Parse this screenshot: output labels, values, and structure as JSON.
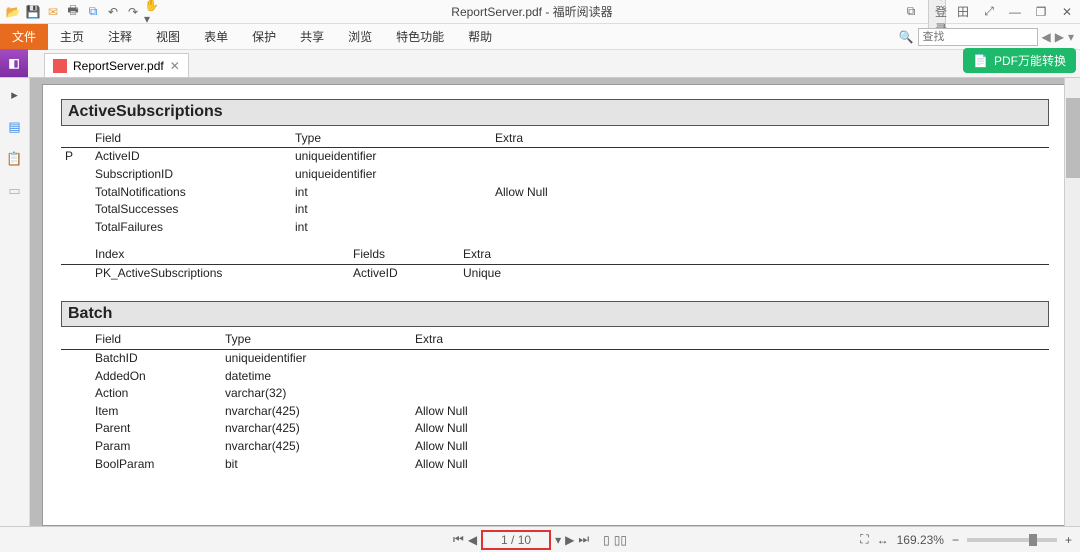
{
  "window": {
    "title": "ReportServer.pdf - 福昕阅读器",
    "not_logged_in": "未登录"
  },
  "qat_icons": [
    "folder-open",
    "save",
    "mail",
    "print",
    "undo",
    "redo",
    "hand",
    "select"
  ],
  "menu": {
    "file": "文件",
    "start": "主页",
    "annotate": "注释",
    "view": "视图",
    "form": "表单",
    "protect": "保护",
    "share": "共享",
    "browse": "浏览",
    "special": "特色功能",
    "help": "帮助"
  },
  "search": {
    "placeholder": "查找"
  },
  "promo": "PDF万能转换",
  "tab": {
    "name": "ReportServer.pdf"
  },
  "left_icons": {
    "nav": "nav-pane-icon",
    "page": "page-icon",
    "copy": "copy-icon",
    "note": "note-icon"
  },
  "doc": {
    "section1": {
      "title": "ActiveSubscriptions",
      "field_hdr": {
        "p": "",
        "f": "Field",
        "t": "Type",
        "e": "Extra"
      },
      "rows": [
        {
          "p": "P",
          "f": "ActiveID",
          "t": "uniqueidentifier",
          "e": ""
        },
        {
          "p": "",
          "f": "SubscriptionID",
          "t": "uniqueidentifier",
          "e": ""
        },
        {
          "p": "",
          "f": "TotalNotifications",
          "t": "int",
          "e": "Allow Null"
        },
        {
          "p": "",
          "f": "TotalSuccesses",
          "t": "int",
          "e": ""
        },
        {
          "p": "",
          "f": "TotalFailures",
          "t": "int",
          "e": ""
        }
      ],
      "idx_hdr": {
        "i": "Index",
        "f": "Fields",
        "e": "Extra"
      },
      "idx_rows": [
        {
          "i": "PK_ActiveSubscriptions",
          "f": "ActiveID",
          "e": "Unique"
        }
      ]
    },
    "section2": {
      "title": "Batch",
      "field_hdr": {
        "f": "Field",
        "t": "Type",
        "e": "Extra"
      },
      "rows": [
        {
          "f": "BatchID",
          "t": "uniqueidentifier",
          "e": ""
        },
        {
          "f": "AddedOn",
          "t": "datetime",
          "e": ""
        },
        {
          "f": "Action",
          "t": "varchar(32)",
          "e": ""
        },
        {
          "f": "Item",
          "t": "nvarchar(425)",
          "e": "Allow Null"
        },
        {
          "f": "Parent",
          "t": "nvarchar(425)",
          "e": "Allow Null"
        },
        {
          "f": "Param",
          "t": "nvarchar(425)",
          "e": "Allow Null"
        },
        {
          "f": "BoolParam",
          "t": "bit",
          "e": "Allow Null"
        }
      ]
    }
  },
  "status": {
    "page": "1 / 10",
    "zoom": "169.23%"
  },
  "winbtns": {
    "min": "—",
    "max": "❐",
    "close": "✕",
    "layout": "田",
    "shrink": "⤢",
    "bookmark": "⧉"
  }
}
